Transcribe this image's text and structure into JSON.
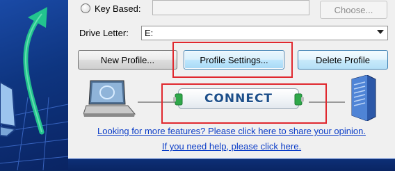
{
  "key_based": {
    "label": "Key Based:",
    "choose_button": "Choose..."
  },
  "drive": {
    "label": "Drive Letter:",
    "value": "E:"
  },
  "buttons": {
    "new_profile": "New Profile...",
    "profile_settings": "Profile Settings...",
    "delete_profile": "Delete Profile"
  },
  "connect": {
    "label": "CONNECT"
  },
  "links": {
    "features": "Looking for more features? Please click here to share your opinion.",
    "help": "If you need help, please click here."
  },
  "colors": {
    "highlight": "#e0282e",
    "link": "#0a3cc7",
    "connect_text": "#1d4f8a",
    "plug_green": "#2fa84a"
  }
}
